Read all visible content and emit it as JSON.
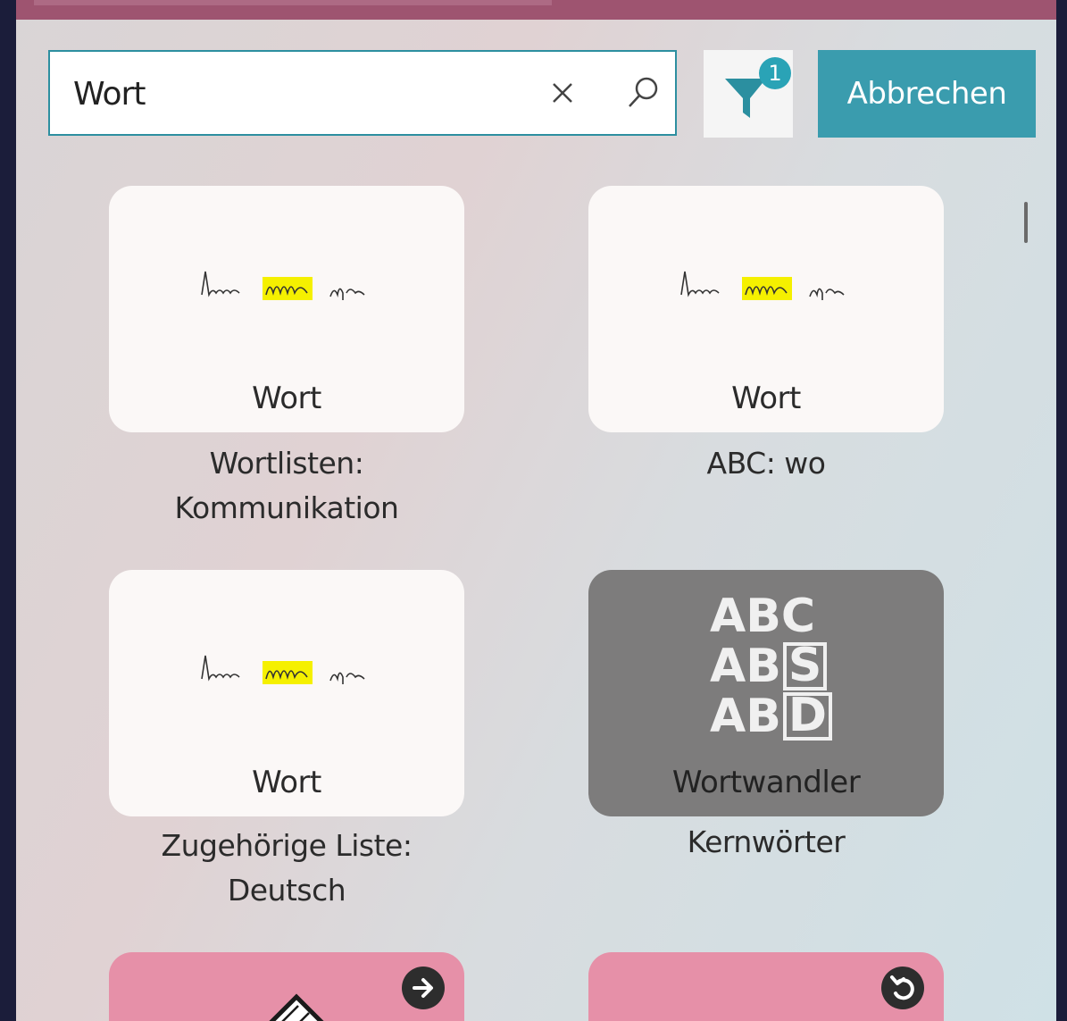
{
  "search": {
    "value": "Wort",
    "clear_icon": "close-icon",
    "search_icon": "search-icon"
  },
  "filter": {
    "icon": "filter-icon",
    "badge": "1"
  },
  "cancel_label": "Abbrechen",
  "results": [
    {
      "tile_label": "Wort",
      "caption_line1": "Wortlisten:",
      "caption_line2": "Kommunikation",
      "style": "light"
    },
    {
      "tile_label": "Wort",
      "caption_line1": "ABC: wo",
      "caption_line2": "",
      "style": "light"
    },
    {
      "tile_label": "Wort",
      "caption_line1": "Zugehörige Liste:",
      "caption_line2": "Deutsch",
      "style": "light"
    },
    {
      "tile_label": "Wortwandler",
      "caption_line1": "Kernwörter",
      "caption_line2": "",
      "style": "dark",
      "abc_rows": [
        "ABC",
        "AB",
        "S",
        "AB",
        "D"
      ]
    },
    {
      "style": "pink",
      "corner_icon": "arrow-right-circle-icon"
    },
    {
      "style": "pink",
      "corner_icon": "undo-circle-icon"
    }
  ],
  "colors": {
    "accent": "#3a9cae",
    "topbar": "#9e5470",
    "pink_tile": "#e690a8",
    "dark_tile": "#7d7c7c",
    "highlight": "#f5f000"
  }
}
